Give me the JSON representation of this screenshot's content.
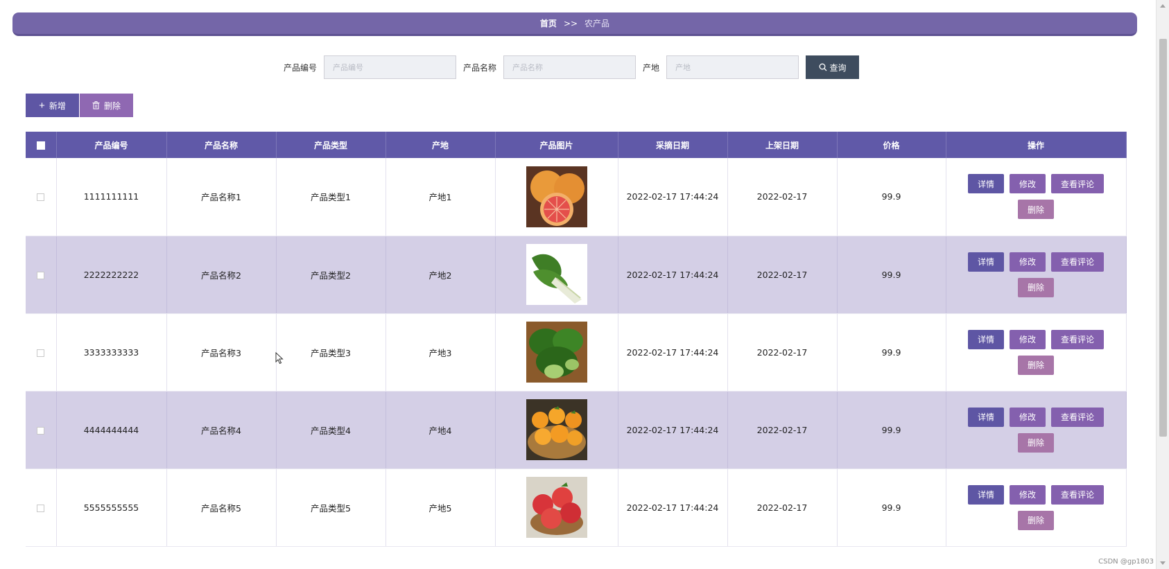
{
  "breadcrumb": {
    "home": "首页",
    "separator": ">>",
    "current": "农产品"
  },
  "search": {
    "fields": [
      {
        "label": "产品编号",
        "placeholder": "产品编号"
      },
      {
        "label": "产品名称",
        "placeholder": "产品名称"
      },
      {
        "label": "产地",
        "placeholder": "产地"
      }
    ],
    "button_label": "查询"
  },
  "toolbar": {
    "add_label": "新增",
    "delete_label": "删除"
  },
  "table": {
    "columns": [
      "产品编号",
      "产品名称",
      "产品类型",
      "产地",
      "产品图片",
      "采摘日期",
      "上架日期",
      "价格",
      "操作"
    ],
    "rows": [
      {
        "id": "1111111111",
        "name": "产品名称1",
        "type": "产品类型1",
        "origin": "产地1",
        "picked": "2022-02-17 17:44:24",
        "listed": "2022-02-17",
        "price": "99.9",
        "image": "grapefruit"
      },
      {
        "id": "2222222222",
        "name": "产品名称2",
        "type": "产品类型2",
        "origin": "产地2",
        "picked": "2022-02-17 17:44:24",
        "listed": "2022-02-17",
        "price": "99.9",
        "image": "bok-choy"
      },
      {
        "id": "3333333333",
        "name": "产品名称3",
        "type": "产品类型3",
        "origin": "产地3",
        "picked": "2022-02-17 17:44:24",
        "listed": "2022-02-17",
        "price": "99.9",
        "image": "greens"
      },
      {
        "id": "4444444444",
        "name": "产品名称4",
        "type": "产品类型4",
        "origin": "产地4",
        "picked": "2022-02-17 17:44:24",
        "listed": "2022-02-17",
        "price": "99.9",
        "image": "oranges"
      },
      {
        "id": "5555555555",
        "name": "产品名称5",
        "type": "产品类型5",
        "origin": "产地5",
        "picked": "2022-02-17 17:44:24",
        "listed": "2022-02-17",
        "price": "99.9",
        "image": "apples"
      }
    ],
    "ops": {
      "detail": "详情",
      "edit": "修改",
      "review": "查看评论",
      "remove": "删除"
    }
  },
  "watermark": "CSDN @gp1803",
  "colors": {
    "header": "#6059a8",
    "breadcrumb": "#7466a8",
    "stripe": "#d4cfe6",
    "search_button": "#3e4c5e"
  }
}
